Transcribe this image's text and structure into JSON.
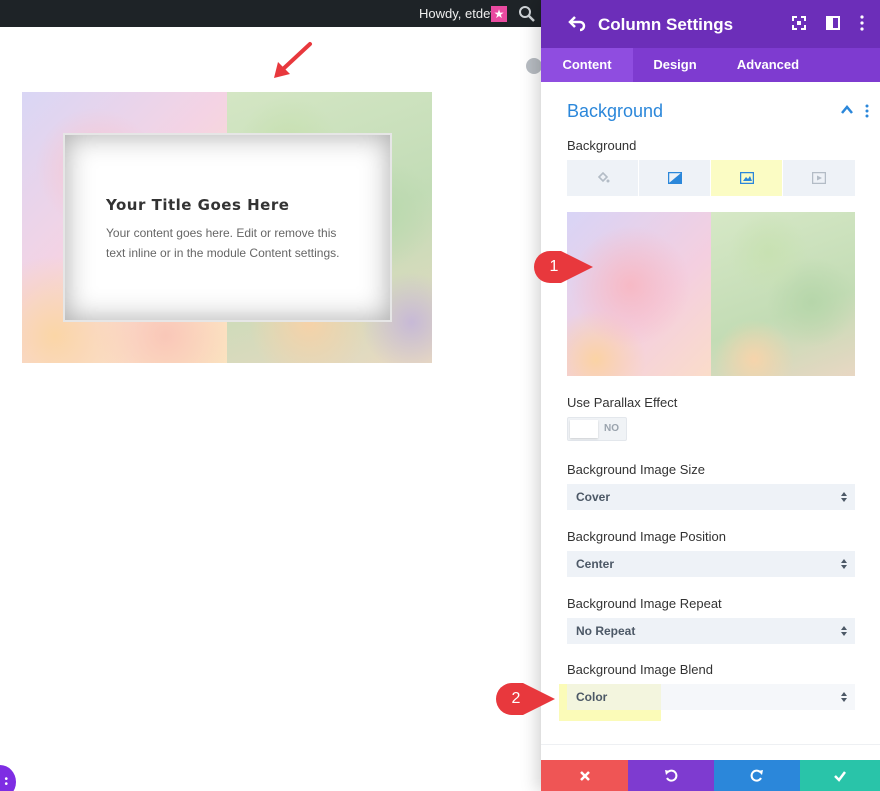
{
  "adminbar": {
    "howdy": "Howdy, etdev"
  },
  "canvas": {
    "card_title": "Your Title Goes Here",
    "card_body": "Your content goes here. Edit or remove this text inline or in the module Content settings."
  },
  "panel": {
    "title": "Column Settings",
    "tabs": [
      {
        "label": "Content",
        "active": true
      },
      {
        "label": "Design",
        "active": false
      },
      {
        "label": "Advanced",
        "active": false
      }
    ],
    "section_title": "Background",
    "background_label": "Background",
    "parallax_label": "Use Parallax Effect",
    "parallax_value": "NO",
    "fields": [
      {
        "label": "Background Image Size",
        "value": "Cover"
      },
      {
        "label": "Background Image Position",
        "value": "Center"
      },
      {
        "label": "Background Image Repeat",
        "value": "No Repeat"
      },
      {
        "label": "Background Image Blend",
        "value": "Color"
      }
    ],
    "footer_colors": {
      "cancel": "#ef5555",
      "undo": "#7e3bd0",
      "redo": "#2b87da",
      "save": "#29c4a9"
    }
  },
  "callouts": [
    "1",
    "2"
  ],
  "colors": {
    "header": "#6c2eb9",
    "tabs": "#7e3bd0",
    "accent": "#2b87da",
    "callout": "#e8383d"
  }
}
